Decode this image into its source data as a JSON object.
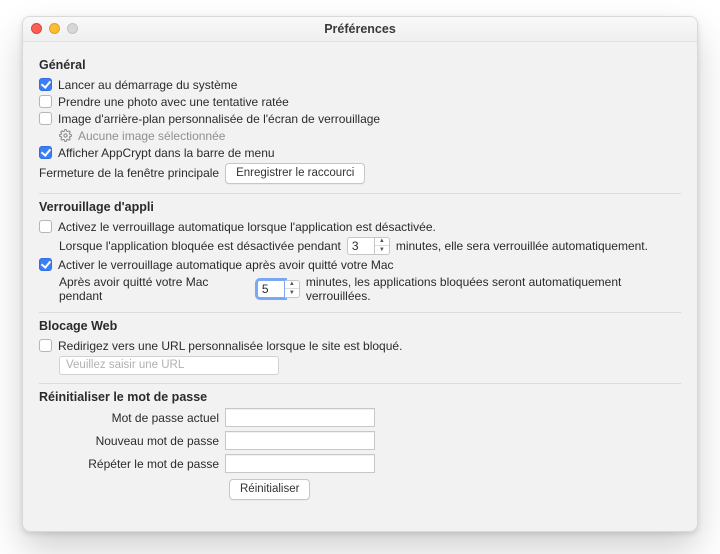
{
  "window": {
    "title": "Préférences"
  },
  "general": {
    "heading": "Général",
    "launch_at_startup": {
      "label": "Lancer au démarrage du système",
      "checked": true
    },
    "photo_on_fail": {
      "label": "Prendre une photo avec une tentative ratée",
      "checked": false
    },
    "custom_lock_bg": {
      "label": "Image d'arrière-plan personnalisée de l'écran de verrouillage",
      "checked": false
    },
    "no_image_label": "Aucune image sélectionnée",
    "show_menubar": {
      "label": "Afficher AppCrypt dans la barre de menu",
      "checked": true
    },
    "close_main_label": "Fermeture de la fenêtre principale",
    "record_shortcut": "Enregistrer le raccourci"
  },
  "applock": {
    "heading": "Verrouillage d'appli",
    "autolock_deactivated": {
      "label": "Activez le verrouillage automatique lorsque l'application est désactivée.",
      "checked": false
    },
    "deact_sub_prefix": "Lorsque l'application bloquée est désactivée pendant",
    "deact_minutes": "3",
    "deact_sub_suffix": "minutes, elle sera verrouillée automatiquement.",
    "autolock_away": {
      "label": "Activer le verrouillage automatique après avoir quitté votre Mac",
      "checked": true
    },
    "away_sub_prefix": "Après avoir quitté votre Mac pendant",
    "away_minutes": "5",
    "away_sub_suffix": "minutes, les applications bloquées seront automatiquement verrouillées."
  },
  "webblock": {
    "heading": "Blocage Web",
    "redirect": {
      "label": "Redirigez vers une URL personnalisée lorsque le site est bloqué.",
      "checked": false
    },
    "url_placeholder": "Veuillez saisir une URL"
  },
  "password": {
    "heading": "Réinitialiser le mot de passe",
    "current": "Mot de passe actuel",
    "new": "Nouveau mot de passe",
    "repeat": "Répéter le mot de passe",
    "reset_button": "Réinitialiser"
  }
}
